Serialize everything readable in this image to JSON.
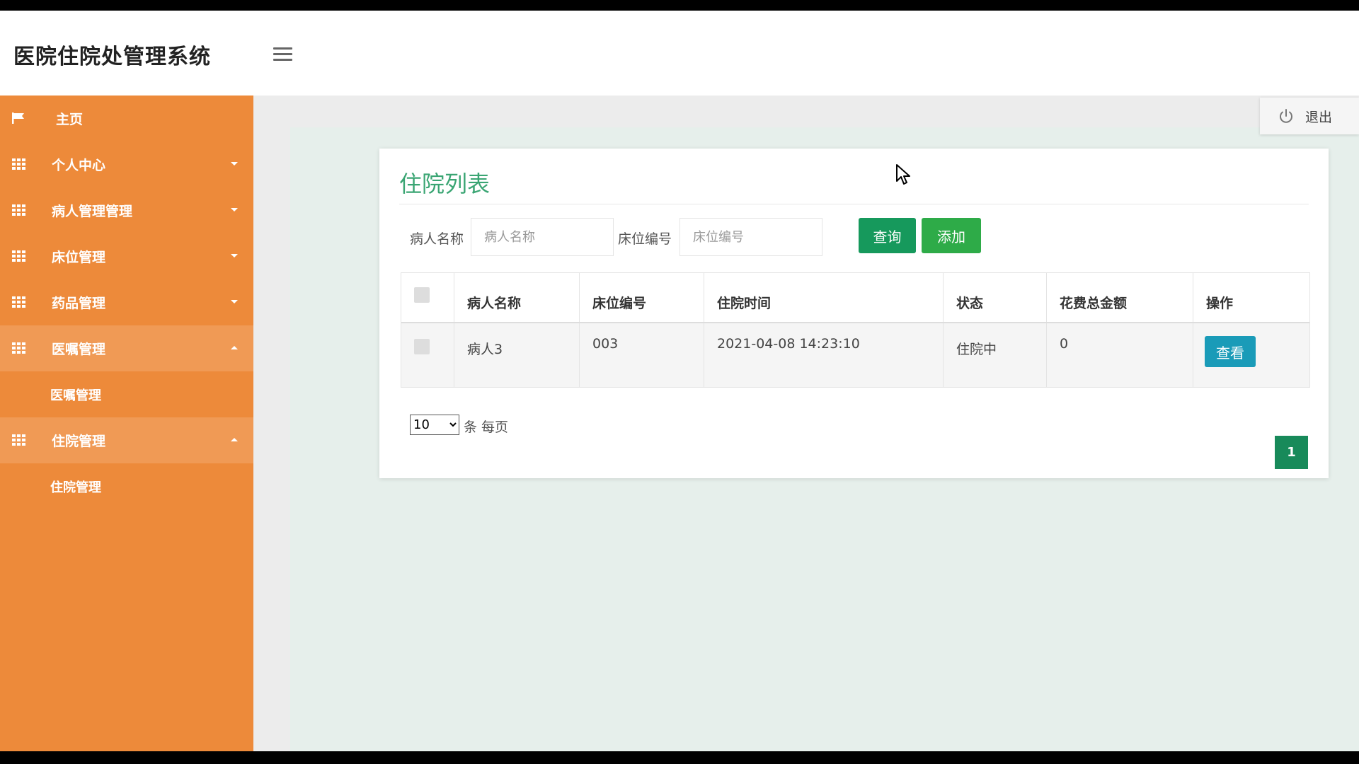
{
  "app": {
    "title": "医院住院处管理系统"
  },
  "header": {
    "logout_label": "退出"
  },
  "sidebar": {
    "items": [
      {
        "label": "主页"
      },
      {
        "label": "个人中心"
      },
      {
        "label": "病人管理管理"
      },
      {
        "label": "床位管理"
      },
      {
        "label": "药品管理"
      },
      {
        "label": "医嘱管理",
        "sub": "医嘱管理"
      },
      {
        "label": "住院管理",
        "sub": "住院管理"
      }
    ]
  },
  "main": {
    "title": "住院列表",
    "filters": {
      "patient_label": "病人名称",
      "patient_placeholder": "病人名称",
      "bed_label": "床位编号",
      "bed_placeholder": "床位编号"
    },
    "query_label": "查询",
    "add_label": "添加",
    "table": {
      "columns": [
        "病人名称",
        "床位编号",
        "住院时间",
        "状态",
        "花费总金额",
        "操作"
      ],
      "rows": [
        {
          "patient": "病人3",
          "bed": "003",
          "time": "2021-04-08 14:23:10",
          "status": "住院中",
          "cost": "0",
          "action": "查看"
        }
      ]
    },
    "page_size": "10",
    "per_page_label": "条 每页",
    "current_page": "1"
  }
}
